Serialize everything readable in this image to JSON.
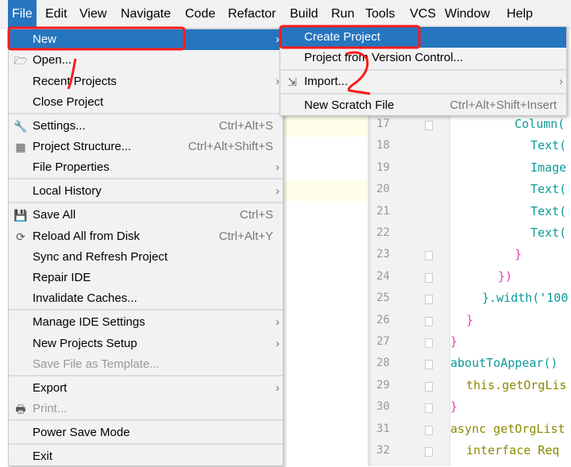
{
  "menubar": [
    "File",
    "Edit",
    "View",
    "Navigate",
    "Code",
    "Refactor",
    "Build",
    "Run",
    "Tools",
    "VCS",
    "Window",
    "Help"
  ],
  "file_menu": [
    {
      "label": "New",
      "arrow": true,
      "selected": true
    },
    {
      "label": "Open...",
      "icon": "folder-open-icon"
    },
    {
      "label": "Recent Projects",
      "arrow": true
    },
    {
      "label": "Close Project"
    },
    {
      "label": "Settings...",
      "shortcut": "Ctrl+Alt+S",
      "icon": "wrench-icon"
    },
    {
      "label": "Project Structure...",
      "shortcut": "Ctrl+Alt+Shift+S",
      "icon": "project-structure-icon"
    },
    {
      "label": "File Properties",
      "arrow": true
    },
    {
      "label": "Local History",
      "arrow": true
    },
    {
      "label": "Save All",
      "shortcut": "Ctrl+S",
      "icon": "save-icon"
    },
    {
      "label": "Reload All from Disk",
      "shortcut": "Ctrl+Alt+Y",
      "icon": "reload-icon"
    },
    {
      "label": "Sync and Refresh Project"
    },
    {
      "label": "Repair IDE"
    },
    {
      "label": "Invalidate Caches..."
    },
    {
      "label": "Manage IDE Settings",
      "arrow": true
    },
    {
      "label": "New Projects Setup",
      "arrow": true
    },
    {
      "label": "Save File as Template...",
      "disabled": true
    },
    {
      "label": "Export",
      "arrow": true
    },
    {
      "label": "Print...",
      "disabled": true,
      "icon": "print-icon"
    },
    {
      "label": "Power Save Mode"
    },
    {
      "label": "Exit"
    }
  ],
  "new_submenu": [
    {
      "label": "Create Project",
      "selected": true
    },
    {
      "label": "Project from Version Control..."
    },
    {
      "label": "Import...",
      "arrow": true,
      "icon": "import-icon"
    },
    {
      "label": "New Scratch File",
      "shortcut": "Ctrl+Alt+Shift+Insert"
    }
  ],
  "editor": {
    "line_numbers": [
      "17",
      "18",
      "19",
      "20",
      "21",
      "22",
      "23",
      "24",
      "25",
      "26",
      "27",
      "28",
      "29",
      "30",
      "31",
      "32"
    ],
    "lines": [
      "Column(",
      "Text(",
      "Image",
      "Text(",
      "Text(",
      "Text(",
      "}",
      "})",
      "}.width('100",
      "}",
      "}",
      "aboutToAppear()",
      "this.getOrgLis",
      "}",
      "async getOrgList",
      "interface Req"
    ]
  },
  "annotations": [
    "1",
    "2"
  ],
  "colors": {
    "selection": "#2675bf",
    "annotation": "#ff1a1a"
  }
}
